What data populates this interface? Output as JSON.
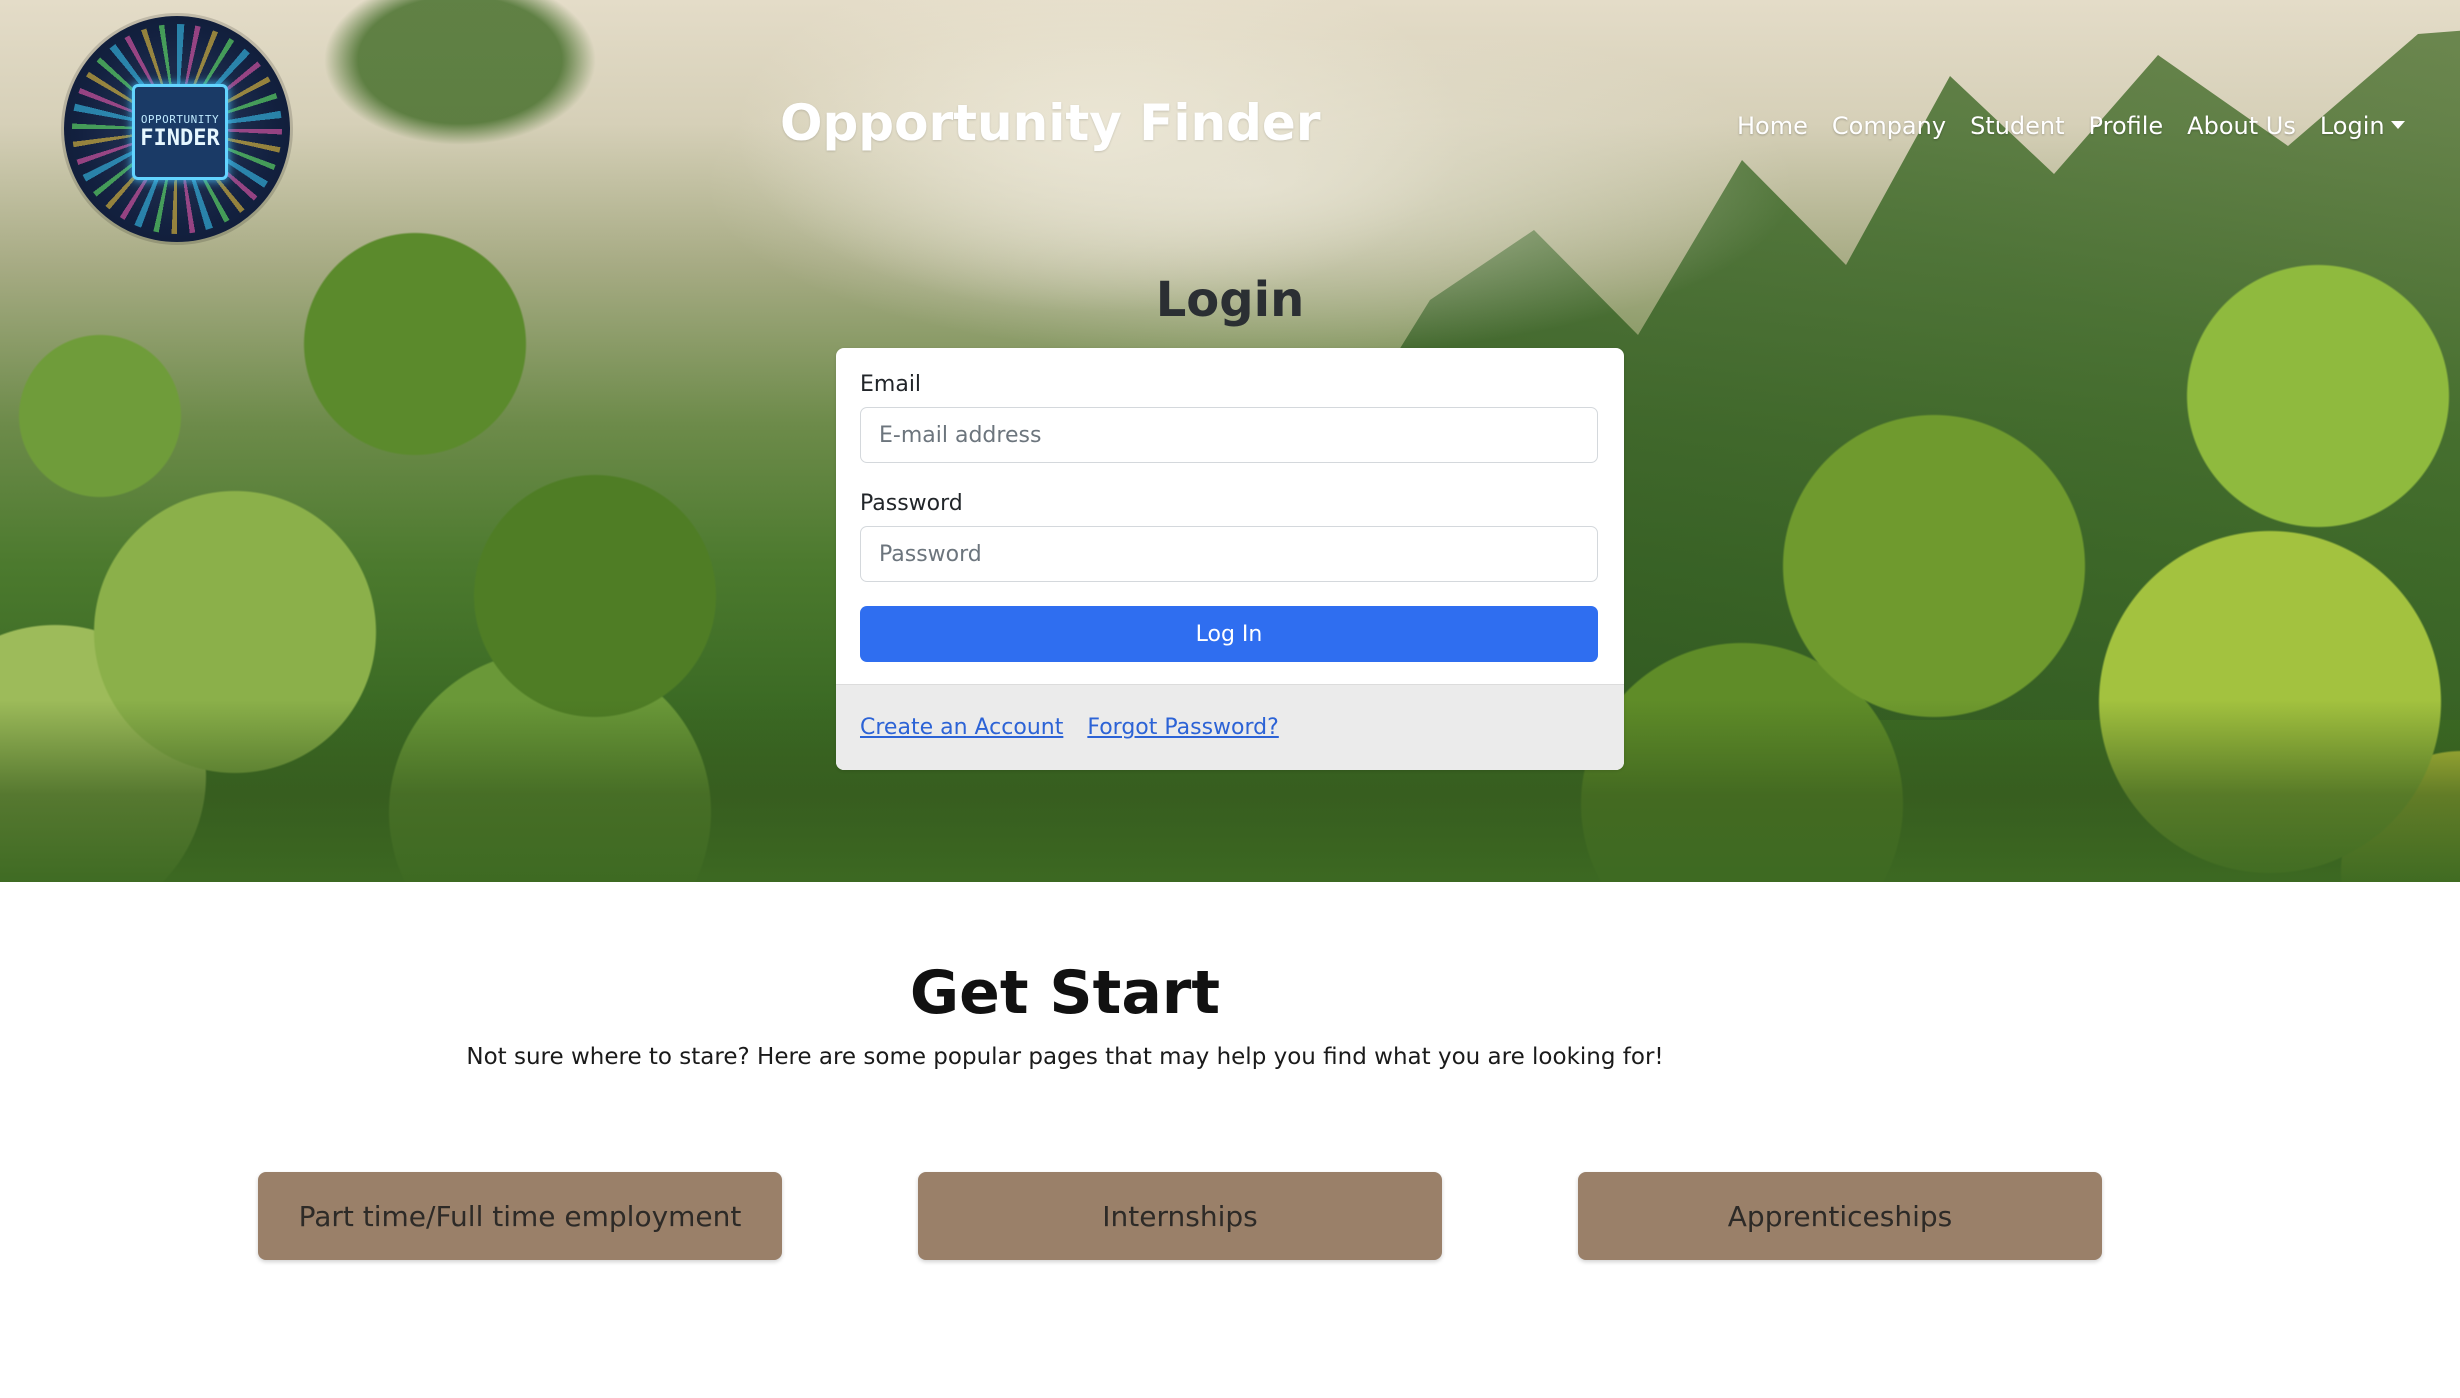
{
  "header": {
    "site_title": "Opportunity Finder",
    "logo": {
      "line1": "OPPORTUNITY",
      "line2": "FINDER"
    },
    "nav": {
      "home": "Home",
      "company": "Company",
      "student": "Student",
      "profile": "Profile",
      "about": "About Us",
      "login": "Login"
    }
  },
  "login": {
    "heading": "Login",
    "email_label": "Email",
    "email_placeholder": "E-mail address",
    "password_label": "Password",
    "password_placeholder": "Password",
    "submit_label": "Log In",
    "create_account": "Create an Account",
    "forgot_password": "Forgot Password?"
  },
  "get_start": {
    "title": "Get Start",
    "subtitle": "Not sure where to stare? Here are some popular pages that may help you find what you are looking for!",
    "buttons": [
      "Part time/Full time employment",
      "Internships",
      "Apprenticeships"
    ]
  },
  "colors": {
    "primary_button": "#2f6ef0",
    "category_button": "#9a8069",
    "link": "#2c63d6"
  }
}
